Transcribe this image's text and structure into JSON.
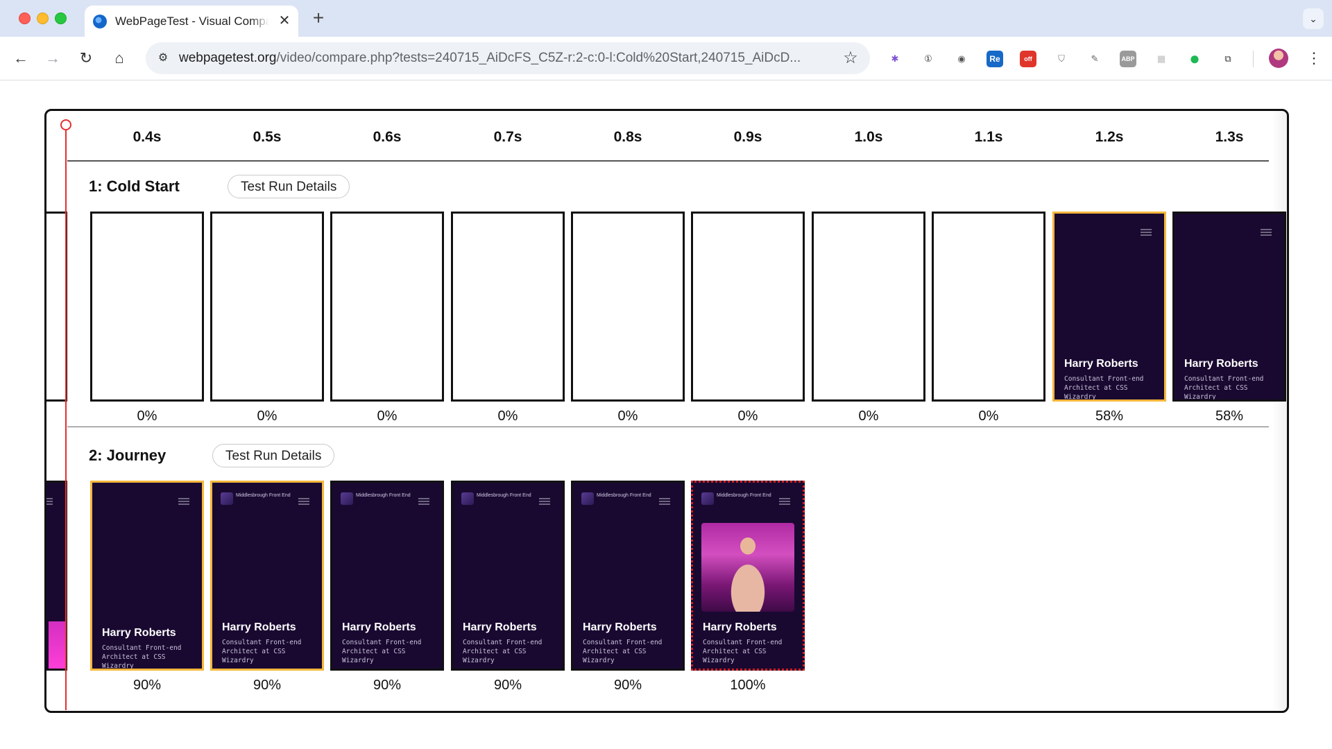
{
  "browser": {
    "tab_title": "WebPageTest - Visual Comparison",
    "tab_close": "✕",
    "new_tab": "+",
    "tab_search": "⌄",
    "url_host": "webpagetest.org",
    "url_path": "/video/compare.php?tests=240715_AiDcFS_C5Z-r:2-c:0-l:Cold%20Start,240715_AiDcD...",
    "nav": {
      "back": "←",
      "forward": "→",
      "reload": "↻",
      "home": "⌂"
    },
    "omnibox_tune": "⚙",
    "bookmark": "☆",
    "extensions": [
      {
        "name": "dark-reader-icon",
        "glyph": "✱",
        "color": "#7b52d6"
      },
      {
        "name": "onepassword-icon",
        "glyph": "①",
        "color": "#333333"
      },
      {
        "name": "camera-icon",
        "glyph": "◉",
        "color": "#555555"
      },
      {
        "name": "re-icon",
        "glyph": "Re",
        "color": "#ffffff",
        "bg": "#1769c7"
      },
      {
        "name": "ext-off-icon",
        "glyph": "off",
        "color": "#ffffff",
        "bg": "#e0352b"
      },
      {
        "name": "shield-icon",
        "glyph": "⛉",
        "color": "#777777"
      },
      {
        "name": "pin-icon",
        "glyph": "✎",
        "color": "#666666"
      },
      {
        "name": "abp-icon",
        "glyph": "ABP",
        "color": "#ffffff",
        "bg": "#9a9a9a"
      },
      {
        "name": "grid-icon",
        "glyph": "▦",
        "color": "#bdbdbd"
      },
      {
        "name": "green-dot-icon",
        "glyph": "●",
        "color": "#1db954"
      },
      {
        "name": "puzzle-icon",
        "glyph": "⧉",
        "color": "#333333"
      }
    ],
    "menu": "⋮"
  },
  "timeline": {
    "ticks": [
      "0.4s",
      "0.5s",
      "0.6s",
      "0.7s",
      "0.8s",
      "0.9s",
      "1.0s",
      "1.1s",
      "1.2s",
      "1.3s"
    ]
  },
  "rows": [
    {
      "title": "1: Cold Start",
      "details_label": "Test Run Details",
      "frames": [
        {
          "state": "blank",
          "percent": "0%"
        },
        {
          "state": "blank",
          "percent": "0%"
        },
        {
          "state": "blank",
          "percent": "0%"
        },
        {
          "state": "blank",
          "percent": "0%"
        },
        {
          "state": "blank",
          "percent": "0%"
        },
        {
          "state": "blank",
          "percent": "0%"
        },
        {
          "state": "blank",
          "percent": "0%"
        },
        {
          "state": "blank",
          "percent": "0%"
        },
        {
          "state": "dark",
          "changed": true,
          "name": "Harry Roberts",
          "subtitle": "Consultant Front-end Architect at CSS Wizardry",
          "percent": "58%"
        },
        {
          "state": "dark",
          "changed": false,
          "name": "Harry Roberts",
          "subtitle": "Consultant Front-end Architect at CSS Wizardry",
          "percent": "58%"
        }
      ]
    },
    {
      "title": "2: Journey",
      "details_label": "Test Run Details",
      "frames": [
        {
          "state": "dark",
          "changed": true,
          "name": "Harry Roberts",
          "subtitle": "Consultant Front-end Architect at CSS Wizardry",
          "percent": "90%"
        },
        {
          "state": "dark",
          "changed": true,
          "logo": "Middlesbrough Front End",
          "name": "Harry Roberts",
          "subtitle": "Consultant Front-end Architect at CSS Wizardry",
          "percent": "90%"
        },
        {
          "state": "dark",
          "changed": false,
          "logo": "Middlesbrough Front End",
          "name": "Harry Roberts",
          "subtitle": "Consultant Front-end Architect at CSS Wizardry",
          "percent": "90%"
        },
        {
          "state": "dark",
          "changed": false,
          "logo": "Middlesbrough Front End",
          "name": "Harry Roberts",
          "subtitle": "Consultant Front-end Architect at CSS Wizardry",
          "percent": "90%"
        },
        {
          "state": "dark",
          "changed": false,
          "logo": "Middlesbrough Front End",
          "name": "Harry Roberts",
          "subtitle": "Consultant Front-end Architect at CSS Wizardry",
          "percent": "90%"
        },
        {
          "state": "dark",
          "final": true,
          "photo": true,
          "logo": "Middlesbrough Front End",
          "name": "Harry Roberts",
          "subtitle": "Consultant Front-end Architect at CSS Wizardry",
          "percent": "100%"
        }
      ]
    }
  ]
}
